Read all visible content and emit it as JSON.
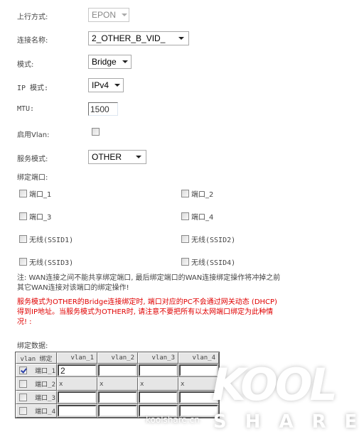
{
  "form": {
    "uplink_mode": {
      "label": "上行方式:",
      "value": "EPON",
      "disabled": true
    },
    "connection_name": {
      "label": "连接名称:",
      "value": "2_OTHER_B_VID_"
    },
    "mode": {
      "label": "模式:",
      "value": "Bridge"
    },
    "ip_mode": {
      "label": "IP 模式:",
      "value": "IPv4"
    },
    "mtu": {
      "label": "MTU:",
      "value": "1500"
    },
    "enable_vlan": {
      "label": "启用Vlan:",
      "checked": false
    },
    "service_mode": {
      "label": "服务模式:",
      "value": "OTHER"
    }
  },
  "bind_ports": {
    "label": "绑定端口:",
    "items": [
      {
        "label": "端口_1",
        "checked": false
      },
      {
        "label": "端口_2",
        "checked": false
      },
      {
        "label": "端口_3",
        "checked": false
      },
      {
        "label": "端口_4",
        "checked": false
      },
      {
        "label": "无线(SSID1)",
        "checked": false
      },
      {
        "label": "无线(SSID2)",
        "checked": false
      },
      {
        "label": "无线(SSID3)",
        "checked": false
      },
      {
        "label": "无线(SSID4)",
        "checked": false
      }
    ]
  },
  "notes": {
    "note_line1": "注: WAN连接之间不能共享绑定端口, 最后绑定端口的WAN连接绑定操作将冲掉之前",
    "note_line2": "其它WAN连接对该端口的绑定操作!",
    "warn_line1": "服务模式为OTHER的Bridge连接绑定时, 端口对应的PC不会通过网关动态 (DHCP)",
    "warn_line2": "得到IP地址。当服务模式为OTHER时, 请注意不要把所有以太网端口绑定为此种情",
    "warn_line3": "况! :",
    "warn_color": "#e00000"
  },
  "bind_data": {
    "label": "绑定数据:",
    "headers": [
      "vlan 绑定",
      "vlan_1",
      "vlan_2",
      "vlan_3",
      "vlan_4"
    ],
    "rows": [
      {
        "port": "端口_1",
        "checked": true,
        "cells": [
          "2",
          "",
          "",
          ""
        ],
        "editable": true
      },
      {
        "port": "端口_2",
        "checked": false,
        "cells": [
          "x",
          "x",
          "x",
          "x"
        ],
        "editable": false
      },
      {
        "port": "端口_3",
        "checked": false,
        "cells": [
          "",
          "",
          "",
          ""
        ],
        "editable": true
      },
      {
        "port": "端口_4",
        "checked": false,
        "cells": [
          "",
          "",
          "",
          ""
        ],
        "editable": true
      }
    ]
  },
  "watermark": {
    "logo": "KOOL",
    "sub": "SHARE",
    "url": "koolshare.cn"
  }
}
